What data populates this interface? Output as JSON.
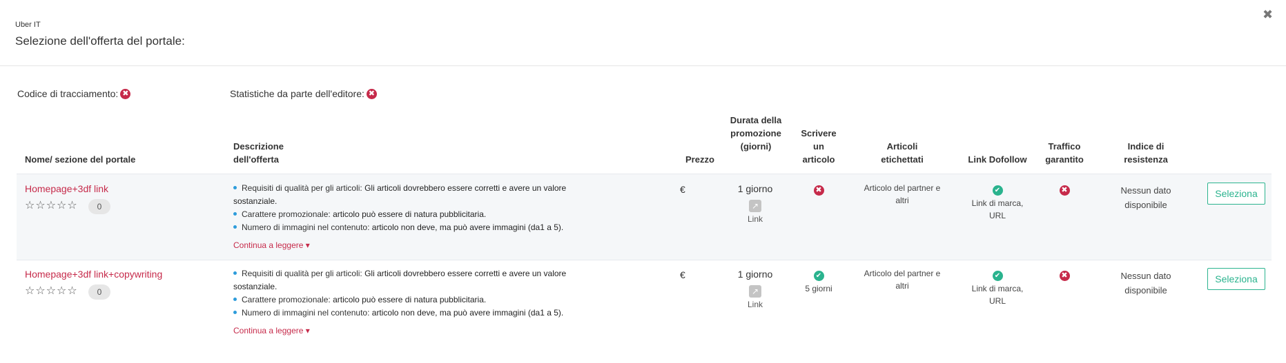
{
  "header": {
    "subtitle": "Uber IT",
    "title": "Selezione dell'offerta del portale:",
    "close_icon": "close-icon"
  },
  "flags": {
    "tracking_label": "Codice di tracciamento:",
    "tracking_status": "no",
    "stats_label": "Statistiche da parte dell'editore:",
    "stats_status": "no"
  },
  "columns": {
    "name": "Nome/ sezione del portale",
    "description": "Descrizione dell'offerta",
    "price": "Prezzo",
    "duration": "Durata della promozione (giorni)",
    "write": "Scrivere un articolo",
    "labeled": "Articoli etichettati",
    "dofollow": "Link Dofollow",
    "traffic": "Traffico garantito",
    "resistance": "Indice di resistenza"
  },
  "colors": {
    "accent_red": "#c62a4a",
    "accent_green": "#2ab38e",
    "bullet_blue": "#2d9cdb"
  },
  "icons": {
    "x": "✖",
    "check": "✔",
    "link": "↗",
    "star": "☆"
  },
  "rows": [
    {
      "name": "Homepage+3df link",
      "stars": "☆☆☆☆☆",
      "reviews": "0",
      "desc": [
        {
          "label": "Requisiti di qualità per gli articoli: ",
          "value": "Gli articoli dovrebbero essere corretti e avere un valore sostanziale."
        },
        {
          "label": "Carattere promozionale: ",
          "value": "articolo può essere di natura pubblicitaria."
        },
        {
          "label": "Numero di immagini nel contenuto: ",
          "value": "articolo non deve, ma può avere immagini (da1 a 5)."
        }
      ],
      "read_more": "Continua a leggere ▾",
      "price": "€",
      "duration": "1 giorno",
      "duration_link": "Link",
      "write_status": "no",
      "write_note": "",
      "labeled": "Articolo del partner e altri",
      "dofollow_status": "yes",
      "dofollow_note": "Link di marca, URL",
      "traffic_status": "no",
      "resistance": "Nessun dato disponibile",
      "button": "Seleziona"
    },
    {
      "name": "Homepage+3df link+copywriting",
      "stars": "☆☆☆☆☆",
      "reviews": "0",
      "desc": [
        {
          "label": "Requisiti di qualità per gli articoli: ",
          "value": "Gli articoli dovrebbero essere corretti e avere un valore sostanziale."
        },
        {
          "label": "Carattere promozionale: ",
          "value": "articolo può essere di natura pubblicitaria."
        },
        {
          "label": "Numero di immagini nel contenuto: ",
          "value": "articolo non deve, ma può avere immagini (da1 a 5)."
        }
      ],
      "read_more": "Continua a leggere ▾",
      "price": "€",
      "duration": "1 giorno",
      "duration_link": "Link",
      "write_status": "yes",
      "write_note": "5 giorni",
      "labeled": "Articolo del partner e altri",
      "dofollow_status": "yes",
      "dofollow_note": "Link di marca, URL",
      "traffic_status": "no",
      "resistance": "Nessun dato disponibile",
      "button": "Seleziona"
    }
  ]
}
